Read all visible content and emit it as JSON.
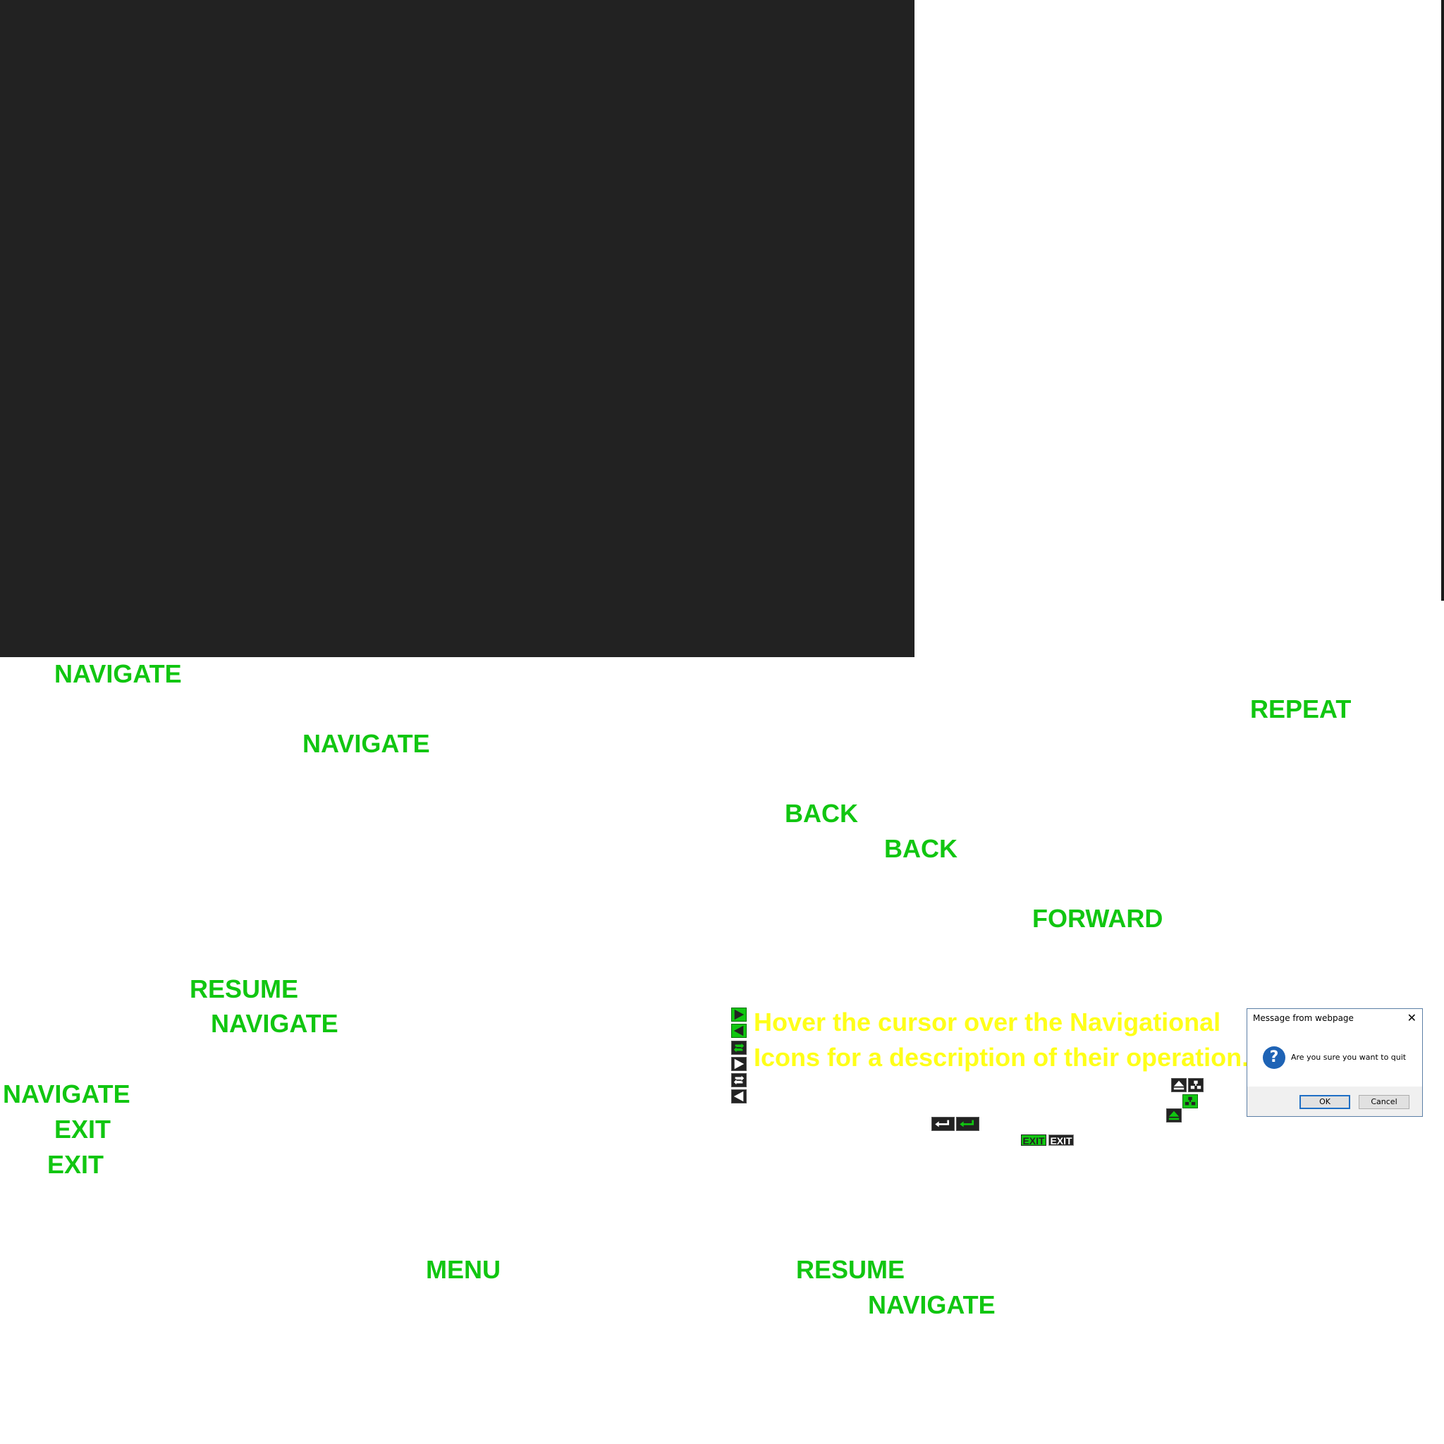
{
  "labels": {
    "navigate_1": "NAVIGATE",
    "navigate_2": "NAVIGATE",
    "repeat": "REPEAT",
    "back_1": "BACK",
    "back_2": "BACK",
    "forward": "FORWARD",
    "resume_1": "RESUME",
    "navigate_3": "NAVIGATE",
    "navigate_4": "NAVIGATE",
    "exit_1": "EXIT",
    "exit_2": "EXIT",
    "menu": "MENU",
    "resume_2": "RESUME",
    "navigate_5": "NAVIGATE"
  },
  "hint": {
    "line1": "Hover the cursor over the Navigational",
    "line2": "Icons for a description of their operation."
  },
  "icons": {
    "exit_green": "EXIT",
    "exit_dark": "EXIT"
  },
  "colors": {
    "label_green": "#11c611",
    "hint_yellow": "#ffff18",
    "stage_dark": "#222222"
  },
  "dialog": {
    "title": "Message from webpage",
    "message": "Are you sure you want to quit",
    "ok_label": "OK",
    "cancel_label": "Cancel"
  }
}
